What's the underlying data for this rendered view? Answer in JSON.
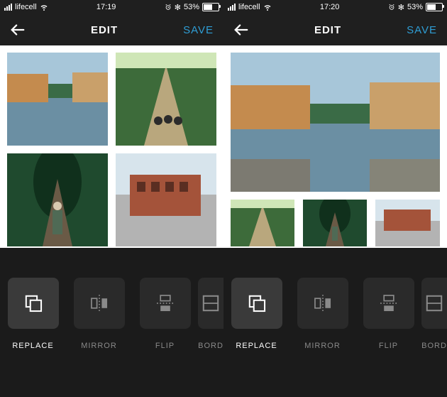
{
  "screens": {
    "left": {
      "status": {
        "carrier": "lifecell",
        "time": "17:19",
        "battery_pct": "53%",
        "alarm": true,
        "bluetooth": true
      },
      "nav": {
        "title": "EDIT",
        "save": "SAVE"
      },
      "tools": [
        {
          "key": "replace",
          "label": "REPLACE",
          "active": true
        },
        {
          "key": "mirror",
          "label": "MIRROR",
          "active": false
        },
        {
          "key": "flip",
          "label": "FLIP",
          "active": false
        },
        {
          "key": "border",
          "label": "BORD",
          "active": false,
          "cut": true
        }
      ]
    },
    "right": {
      "status": {
        "carrier": "lifecell",
        "time": "17:20",
        "battery_pct": "53%",
        "alarm": true,
        "bluetooth": true
      },
      "nav": {
        "title": "EDIT",
        "save": "SAVE"
      },
      "tools": [
        {
          "key": "replace",
          "label": "REPLACE",
          "active": true
        },
        {
          "key": "mirror",
          "label": "MIRROR",
          "active": false
        },
        {
          "key": "flip",
          "label": "FLIP",
          "active": false
        },
        {
          "key": "border",
          "label": "BORD",
          "active": false,
          "cut": true
        }
      ]
    }
  },
  "images": {
    "river": "river-buildings-photo",
    "park": "park-path-people-photo",
    "forest": "forest-railway-person-photo",
    "brick": "brick-building-street-photo"
  }
}
